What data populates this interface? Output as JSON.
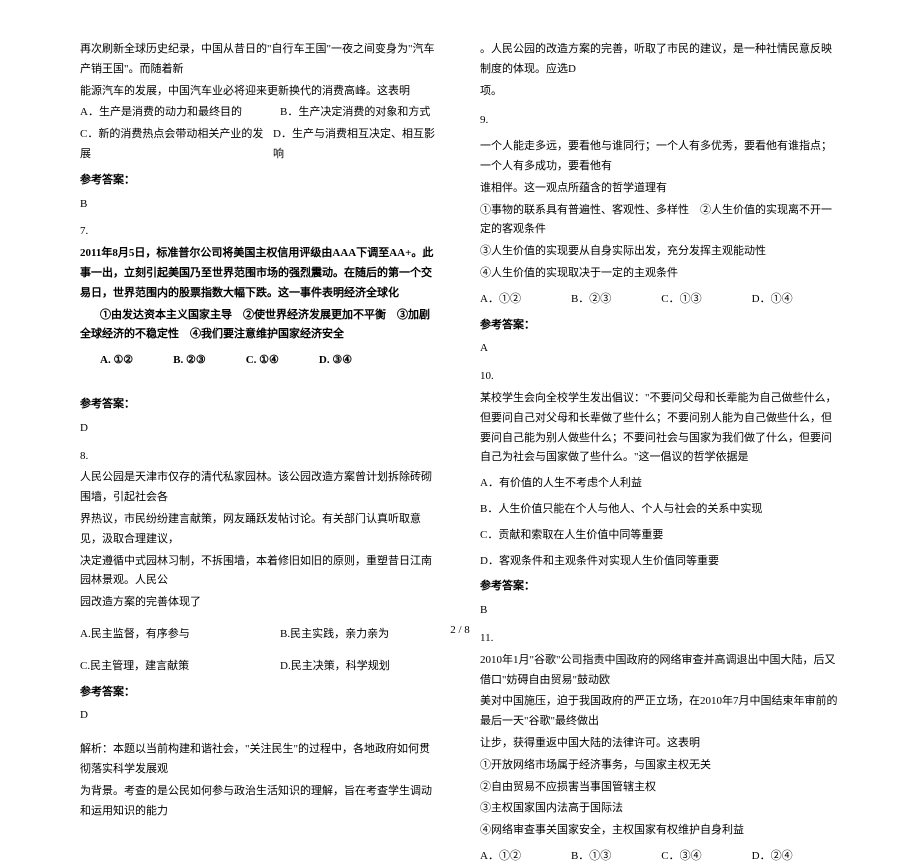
{
  "left": {
    "intro1": "再次刷新全球历史纪录，中国从昔日的\"自行车王国\"一夜之间变身为\"汽车产销王国\"。而随着新",
    "intro2": "能源汽车的发展，中国汽车业必将迎来更新换代的消费高峰。这表明",
    "q6_optA": "A．生产是消费的动力和最终目的",
    "q6_optB": "B．生产决定消费的对象和方式",
    "q6_optC": "C．新的消费热点会带动相关产业的发展",
    "q6_optD": "D．生产与消费相互决定、相互影响",
    "ans_header": "参考答案：",
    "q6_ans": "B",
    "q7_num": "7.",
    "q7_text1": "2011年8月5日，标准普尔公司将美国主权信用评级由AAA下调至AA+。此事一出，立刻引起美国乃至世界范围市场的强烈震动。在随后的第一个交易日，世界范围内的股票指数大幅下跌。这一事件表明经济全球化",
    "q7_circles": "①由发达资本主义国家主导　②使世界经济发展更加不平衡　③加剧全球经济的不稳定性　④我们要注意维护国家经济安全",
    "q7_optA": "A. ①②",
    "q7_optB": "B. ②③",
    "q7_optC": "C. ①④",
    "q7_optD": "D. ③④",
    "q7_ans": "D",
    "q8_num": "8.",
    "q8_text1": "人民公园是天津市仅存的清代私家园林。该公园改造方案曾计划拆除砖砌围墙，引起社会各",
    "q8_text2": "界热议，市民纷纷建言献策，网友踊跃发帖讨论。有关部门认真听取意见，汲取合理建议，",
    "q8_text3": "决定遵循中式园林习制，不拆围墙，本着修旧如旧的原则，重塑昔日江南园林景观。人民公",
    "q8_text4": "园改造方案的完善体现了",
    "q8_optA": "A.民主监督，有序参与",
    "q8_optB": "B.民主实践，亲力亲为",
    "q8_optC": "C.民主管理，建言献策",
    "q8_optD": "D.民主决策，科学规划",
    "q8_ans": "D",
    "q8_analysis1": "解析：本题以当前构建和谐社会，\"关注民生\"的过程中，各地政府如何贯彻落实科学发展观",
    "q8_analysis2": "为背景。考查的是公民如何参与政治生活知识的理解，旨在考查学生调动和运用知识的能力"
  },
  "right": {
    "cont1": "。人民公园的改造方案的完善，听取了市民的建议，是一种社情民意反映制度的体现。应选D",
    "cont2": "项。",
    "q9_num": "9.",
    "q9_text1": "一个人能走多远，要看他与谁同行；一个人有多优秀，要看他有谁指点；一个人有多成功，要看他有",
    "q9_text2": "谁相伴。这一观点所蕴含的哲学道理有",
    "q9_c1": "①事物的联系具有普遍性、客观性、多样性　②人生价值的实现离不开一定的客观条件",
    "q9_c2": "③人生价值的实现要从自身实际出发，充分发挥主观能动性",
    "q9_c3": "④人生价值的实现取决于一定的主观条件",
    "q9_optA": "A．①②",
    "q9_optB": "B．②③",
    "q9_optC": "C．①③",
    "q9_optD": "D．①④",
    "ans_header": "参考答案：",
    "q9_ans": "A",
    "q10_num": "10.",
    "q10_text1": "某校学生会向全校学生发出倡议：\"不要问父母和长辈能为自己做些什么，但要问自己对父母和长辈做了些什么；不要问别人能为自己做些什么，但要问自己能为别人做些什么；不要问社会与国家为我们做了什么，但要问自己为社会与国家做了些什么。\"这一倡议的哲学依据是",
    "q10_optA": "A．有价值的人生不考虑个人利益",
    "q10_optB": "B．人生价值只能在个人与他人、个人与社会的关系中实现",
    "q10_optC": "C．贡献和索取在人生价值中同等重要",
    "q10_optD": "D．客观条件和主观条件对实现人生价值同等重要",
    "q10_ans": "B",
    "q11_num": "11.",
    "q11_text1": "2010年1月\"谷歌\"公司指责中国政府的网络审查并高调退出中国大陆，后又借口\"妨碍自由贸易\"鼓动欧",
    "q11_text2": "美对中国施压，迫于我国政府的严正立场，在2010年7月中国结束年审前的最后一天\"谷歌\"最终做出",
    "q11_text3": "让步，获得重返中国大陆的法律许可。这表明",
    "q11_c1": "①开放网络市场属于经济事务，与国家主权无关",
    "q11_c2": "②自由贸易不应损害当事国管辖主权",
    "q11_c3": "③主权国家国内法高于国际法",
    "q11_c4": "④网络审查事关国家安全，主权国家有权维护自身利益",
    "q11_optA": "A．①②",
    "q11_optB": "B．①③",
    "q11_optC": "C．③④",
    "q11_optD": "D．②④"
  },
  "footer": "2 / 8"
}
